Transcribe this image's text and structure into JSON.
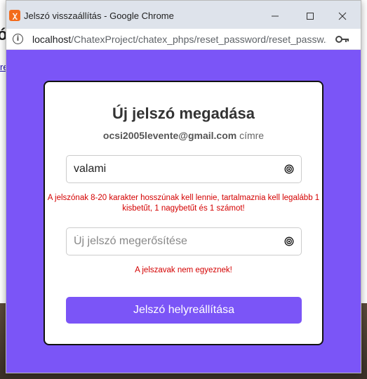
{
  "background": {
    "heading_partial": "ó",
    "link_partial": "re"
  },
  "window": {
    "title": "Jelszó visszaállítás - Google Chrome",
    "app_icon_glyph": "ꭓ",
    "url_host": "localhost",
    "url_path": "/ChatexProject/chatex_phps/reset_password/reset_passw..."
  },
  "form": {
    "title": "Új jelszó megadása",
    "email": "ocsi2005levente@gmail.com",
    "email_suffix": " címre",
    "password_value": "valami",
    "password_placeholder": "",
    "password_error": "A jelszónak 8-20 karakter hosszúnak kell lennie, tartalmaznia kell legalább 1 kisbetűt, 1 nagybetűt és 1 számot!",
    "confirm_value": "",
    "confirm_placeholder": "Új jelszó megerősítése",
    "confirm_error": "A jelszavak nem egyeznek!",
    "submit_label": "Jelszó helyreállítása"
  },
  "colors": {
    "accent": "#7b55f7",
    "error": "#d40000",
    "titlebar": "#dee3eb"
  },
  "icons": {
    "app": "xampp-icon",
    "info": "info-icon",
    "key": "key-icon",
    "eye": "eye-icon"
  }
}
